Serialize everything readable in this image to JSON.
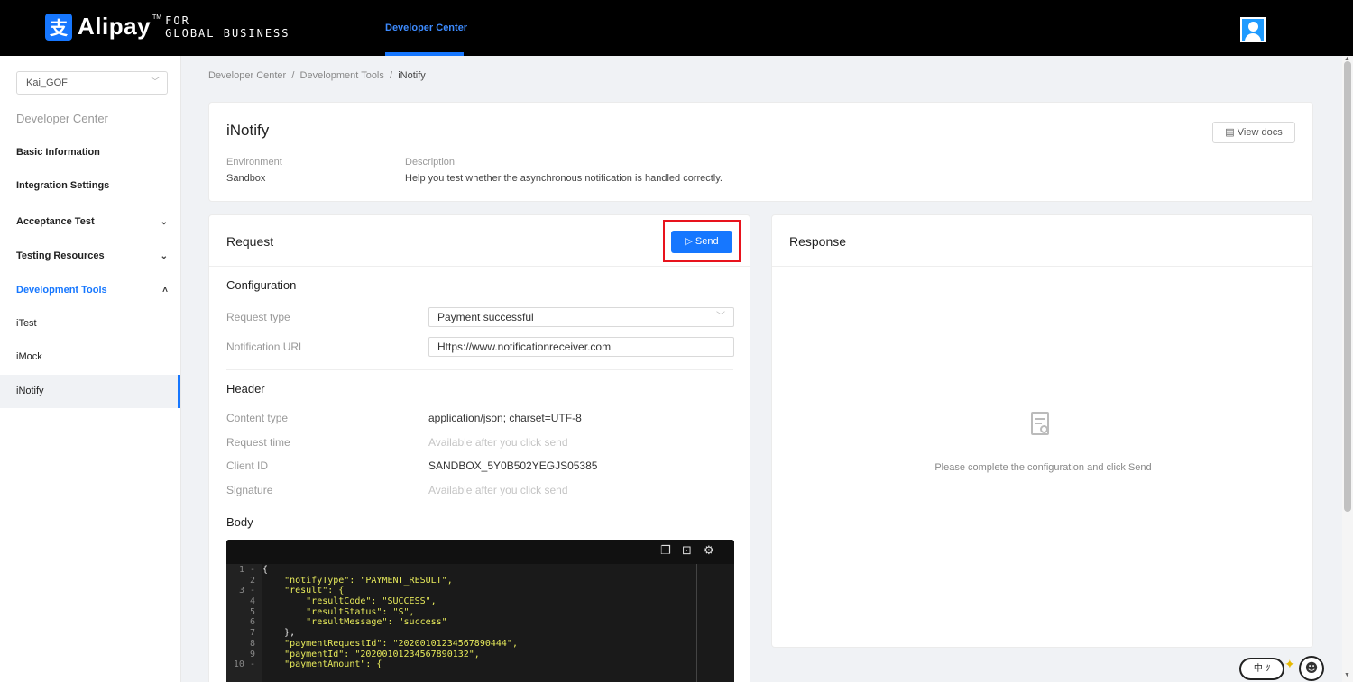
{
  "header": {
    "brand": "Alipay",
    "tm": "TM",
    "brand_sub_1": "FOR",
    "brand_sub_2": "GLOBAL BUSINESS",
    "nav_item": "Developer Center"
  },
  "sidebar": {
    "account": "Kai_GOF",
    "title": "Developer Center",
    "items": [
      {
        "label": "Basic Information"
      },
      {
        "label": "Integration Settings"
      },
      {
        "label": "Acceptance Test"
      },
      {
        "label": "Testing Resources"
      },
      {
        "label": "Development Tools"
      },
      {
        "label": "iTest"
      },
      {
        "label": "iMock"
      },
      {
        "label": "iNotify"
      }
    ]
  },
  "breadcrumb": {
    "items": [
      "Developer Center",
      "Development Tools",
      "iNotify"
    ],
    "sep": "/"
  },
  "page": {
    "title": "iNotify",
    "docs_button": "View docs",
    "environment_label": "Environment",
    "environment_value": "Sandbox",
    "description_label": "Description",
    "description_value": "Help you test whether the asynchronous notification is handled correctly."
  },
  "request": {
    "title": "Request",
    "send_button": "Send",
    "configuration_title": "Configuration",
    "request_type_label": "Request type",
    "request_type_value": "Payment successful",
    "notification_url_label": "Notification URL",
    "notification_url_value": "Https://www.notificationreceiver.com",
    "header_title": "Header",
    "content_type_label": "Content type",
    "content_type_value": "application/json; charset=UTF-8",
    "request_time_label": "Request time",
    "request_time_value": "Available after you click send",
    "client_id_label": "Client ID",
    "client_id_value": "SANDBOX_5Y0B502YEGJS05385",
    "signature_label": "Signature",
    "signature_value": "Available after you click send",
    "body_title": "Body",
    "code_lines": [
      {
        "n": "1 -",
        "t": "{"
      },
      {
        "n": "2",
        "t": "    \"notifyType\": \"PAYMENT_RESULT\","
      },
      {
        "n": "3 -",
        "t": "    \"result\": {"
      },
      {
        "n": "4",
        "t": "        \"resultCode\": \"SUCCESS\","
      },
      {
        "n": "5",
        "t": "        \"resultStatus\": \"S\","
      },
      {
        "n": "6",
        "t": "        \"resultMessage\": \"success\""
      },
      {
        "n": "7",
        "t": "    },"
      },
      {
        "n": "8",
        "t": "    \"paymentRequestId\": \"20200101234567890444\","
      },
      {
        "n": "9",
        "t": "    \"paymentId\": \"20200101234567890132\","
      },
      {
        "n": "10 -",
        "t": "    \"paymentAmount\": {"
      }
    ]
  },
  "response": {
    "title": "Response",
    "empty_text": "Please complete the configuration and click Send"
  },
  "ime": {
    "label": "中 ﾂ"
  }
}
